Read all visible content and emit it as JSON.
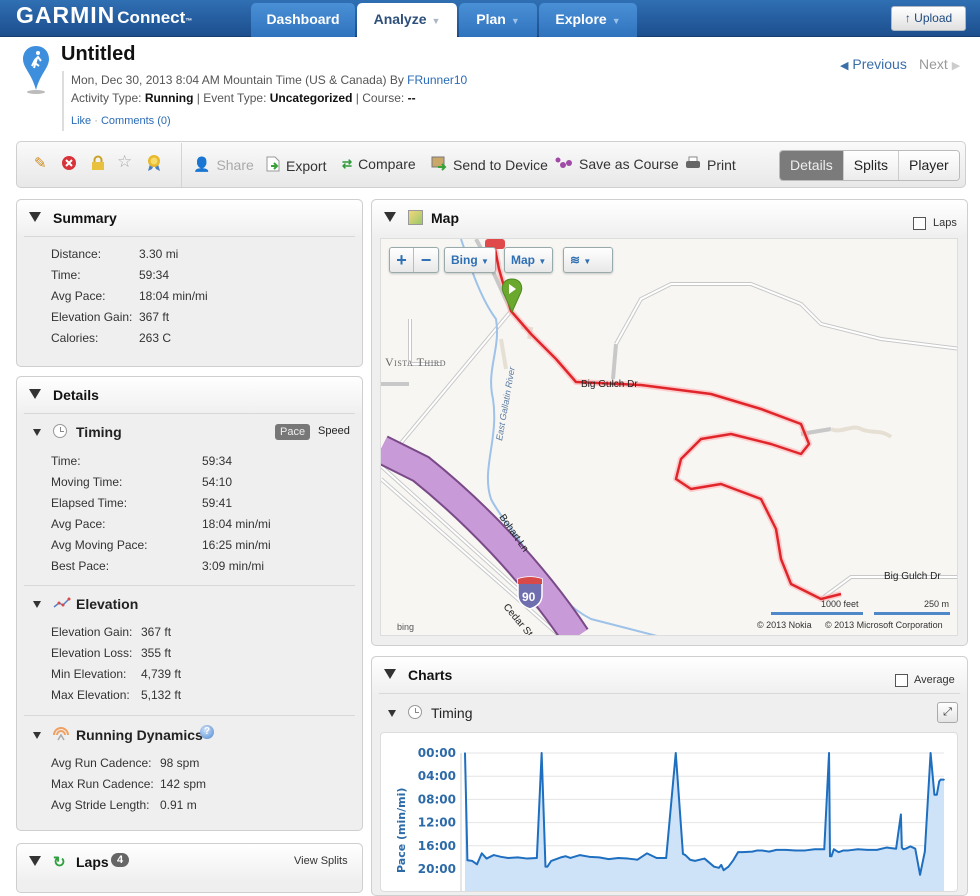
{
  "header": {
    "logo_main": "GARMIN",
    "logo_sub": "Connect",
    "logo_tm": "™",
    "nav": [
      {
        "label": "Dashboard",
        "caret": false,
        "active": false
      },
      {
        "label": "Analyze",
        "caret": true,
        "active": true
      },
      {
        "label": "Plan",
        "caret": true,
        "active": false
      },
      {
        "label": "Explore",
        "caret": true,
        "active": false
      }
    ],
    "upload_label": "Upload",
    "upload_icon": "arrow-up-icon"
  },
  "activity": {
    "title": "Untitled",
    "date_line": "Mon, Dec 30, 2013 8:04 AM Mountain Time (US & Canada) By ",
    "user": "FRunner10",
    "activity_type_label": "Activity Type: ",
    "activity_type": "Running",
    "event_type_label": " | Event Type: ",
    "event_type": "Uncategorized",
    "course_label": " | Course: ",
    "course": "--",
    "like": "Like",
    "separator": " · ",
    "comments": "Comments (0)",
    "previous": "Previous",
    "next": "Next"
  },
  "toolbar": {
    "icons": [
      "pencil-icon",
      "delete-icon",
      "lock-icon",
      "star-icon",
      "award-icon"
    ],
    "actions": [
      {
        "label": "Share",
        "icon": "share-icon",
        "disabled": true
      },
      {
        "label": "Export",
        "icon": "export-icon",
        "disabled": false
      },
      {
        "label": "Compare",
        "icon": "compare-icon",
        "disabled": false
      },
      {
        "label": "Send to Device",
        "icon": "send-to-device-icon",
        "disabled": false
      },
      {
        "label": "Save as Course",
        "icon": "save-course-icon",
        "disabled": false
      },
      {
        "label": "Print",
        "icon": "print-icon",
        "disabled": false
      }
    ],
    "views": [
      {
        "label": "Details",
        "active": true
      },
      {
        "label": "Splits",
        "active": false
      },
      {
        "label": "Player",
        "active": false
      }
    ]
  },
  "summary": {
    "title": "Summary",
    "rows": [
      {
        "k": "Distance:",
        "v": "3.30 mi"
      },
      {
        "k": "Time:",
        "v": "59:34"
      },
      {
        "k": "Avg Pace:",
        "v": "18:04 min/mi"
      },
      {
        "k": "Elevation Gain:",
        "v": "367 ft"
      },
      {
        "k": "Calories:",
        "v": "263 C"
      }
    ]
  },
  "details": {
    "title": "Details",
    "timing": {
      "title": "Timing",
      "toggle": [
        "Pace",
        "Speed"
      ],
      "rows": [
        {
          "k": "Time:",
          "v": "59:34"
        },
        {
          "k": "Moving Time:",
          "v": "54:10"
        },
        {
          "k": "Elapsed Time:",
          "v": "59:41"
        },
        {
          "k": "Avg Pace:",
          "v": "18:04 min/mi"
        },
        {
          "k": "Avg Moving Pace:",
          "v": "16:25 min/mi"
        },
        {
          "k": "Best Pace:",
          "v": "3:09 min/mi"
        }
      ]
    },
    "elevation": {
      "title": "Elevation",
      "rows": [
        {
          "k": "Elevation Gain:",
          "v": "367 ft"
        },
        {
          "k": "Elevation Loss:",
          "v": "355 ft"
        },
        {
          "k": "Min Elevation:",
          "v": "4,739 ft"
        },
        {
          "k": "Max Elevation:",
          "v": "5,132 ft"
        }
      ]
    },
    "dynamics": {
      "title": "Running Dynamics",
      "rows": [
        {
          "k": "Avg Run Cadence:",
          "v": "98 spm"
        },
        {
          "k": "Max Run Cadence:",
          "v": "142 spm"
        },
        {
          "k": "Avg Stride Length:",
          "v": "0.91 m"
        }
      ]
    }
  },
  "laps": {
    "title": "Laps",
    "count": "4",
    "view_splits": "View Splits"
  },
  "map": {
    "title": "Map",
    "laps_label": "Laps",
    "laps_checked": false,
    "provider": "Bing",
    "map_type": "Map",
    "labels": {
      "vista": "Vista Third",
      "river": "East Gallatin River",
      "big_gulch_1": "Big Gulch Dr",
      "big_gulch_2": "Big Gulch Dr",
      "bohart": "Bohart Ln",
      "cedar": "Cedar St",
      "interstate": "90"
    },
    "scale_feet": "1000 feet",
    "scale_m": "250 m",
    "copyright_nokia": "© 2013 Nokia",
    "copyright_ms": "© 2013 Microsoft Corporation",
    "bing_logo": "bing",
    "route_color": "#e0262b"
  },
  "charts": {
    "title": "Charts",
    "average_label": "Average",
    "average_checked": false,
    "timing_title": "Timing"
  },
  "chart_data": {
    "type": "area",
    "title": "Timing",
    "xlabel": "",
    "ylabel": "Pace (min/mi)",
    "y_ticks": [
      "00:00",
      "04:00",
      "08:00",
      "12:00",
      "16:00",
      "20:00"
    ],
    "ylim": [
      0,
      20
    ],
    "y_inverted": true,
    "grid": true,
    "series": [
      {
        "name": "Pace",
        "color": "#1f6fc0",
        "x": [
          0,
          0.005,
          0.015,
          0.025,
          0.035,
          0.045,
          0.06,
          0.075,
          0.09,
          0.11,
          0.13,
          0.15,
          0.16,
          0.168,
          0.172,
          0.18,
          0.19,
          0.2,
          0.21,
          0.22,
          0.24,
          0.26,
          0.28,
          0.3,
          0.32,
          0.34,
          0.36,
          0.38,
          0.4,
          0.42,
          0.44,
          0.455,
          0.46,
          0.47,
          0.48,
          0.5,
          0.52,
          0.53,
          0.535,
          0.54,
          0.55,
          0.56,
          0.57,
          0.58,
          0.6,
          0.61,
          0.62,
          0.635,
          0.65,
          0.67,
          0.69,
          0.71,
          0.73,
          0.75,
          0.76,
          0.762,
          0.765,
          0.77,
          0.78,
          0.79,
          0.8,
          0.82,
          0.84,
          0.86,
          0.88,
          0.9,
          0.91,
          0.912,
          0.915,
          0.92,
          0.93,
          0.94,
          0.95,
          0.96,
          0.972,
          0.98,
          0.985,
          0.99,
          0.993,
          0.996,
          1.0
        ],
        "y": [
          0,
          18.5,
          18.6,
          19.2,
          17.3,
          18.2,
          17.6,
          17.9,
          18.1,
          18.0,
          18.2,
          18.1,
          0,
          19.6,
          19.6,
          18.6,
          18.3,
          18.0,
          17.8,
          18.1,
          17.6,
          17.9,
          18.0,
          18.3,
          18.1,
          18.2,
          18.4,
          17.3,
          18.1,
          18.1,
          0,
          17.4,
          17.6,
          18.4,
          18.6,
          18.2,
          19.6,
          19.8,
          19.3,
          20.2,
          19.6,
          18.5,
          17.1,
          17.1,
          17.0,
          16.8,
          16.8,
          17.0,
          16.7,
          16.7,
          16.8,
          16.8,
          16.6,
          16.6,
          0,
          17.8,
          17.8,
          16.6,
          17.1,
          16.8,
          16.8,
          16.6,
          16.7,
          16.7,
          16.3,
          16.5,
          10.6,
          16.3,
          16.6,
          16.5,
          16.1,
          16.5,
          21.0,
          17.0,
          0,
          7.2,
          7.2,
          4.9,
          4.6,
          4.6,
          4.6
        ]
      }
    ]
  }
}
